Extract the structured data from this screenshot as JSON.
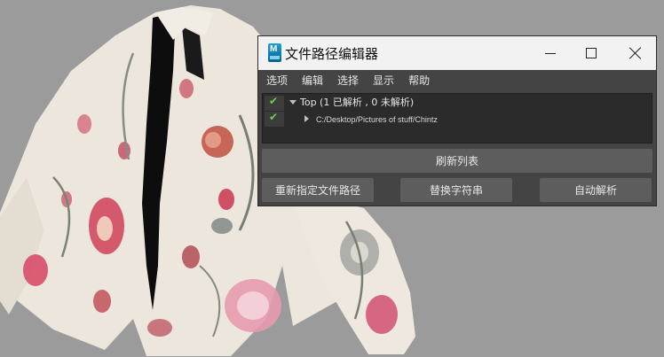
{
  "window": {
    "title": "文件路径编辑器"
  },
  "menu": {
    "items": [
      "选项",
      "编辑",
      "选择",
      "显示",
      "帮助"
    ]
  },
  "tree": {
    "root_label": "Top (1  已解析  , 0 未解析)",
    "child_path": "C:/Desktop/Pictures  of stuff/Chintz",
    "check_glyph": "✔"
  },
  "buttons": {
    "refresh": "刷新列表",
    "remap": "重新指定文件路径",
    "replace": "替换字符串",
    "auto_resolve": "自动解析"
  },
  "icons": {
    "app": "maya-app-icon",
    "minimize": "minimize-icon",
    "maximize": "maximize-icon",
    "close": "close-icon",
    "resolved": "checkmark-icon",
    "expand": "triangle-icon"
  },
  "colors": {
    "viewport_bg": "#9b9b9b",
    "panel_bg": "#444444",
    "tree_bg": "#2b2b2b",
    "button_bg": "#5d5d5d",
    "resolved_check": "#6fd34a"
  }
}
